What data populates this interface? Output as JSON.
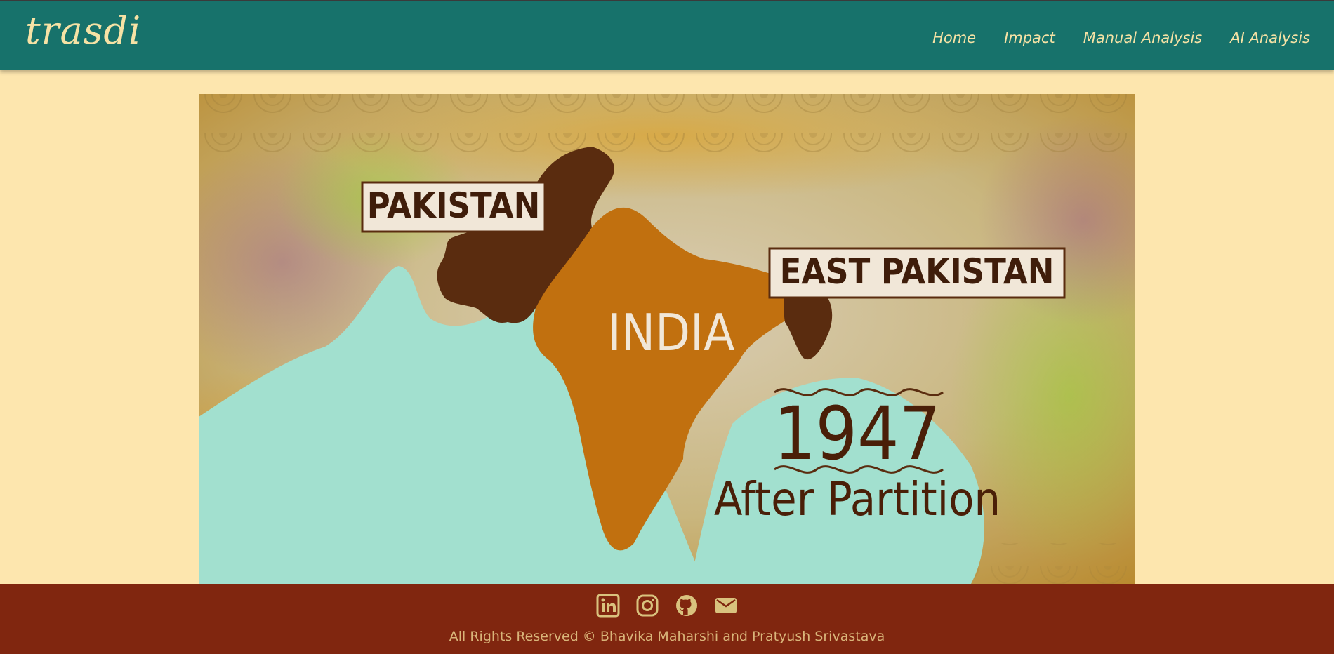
{
  "brand": {
    "name": "trasdi"
  },
  "nav": {
    "items": [
      {
        "label": "Home"
      },
      {
        "label": "Impact"
      },
      {
        "label": "Manual Analysis"
      },
      {
        "label": "AI Analysis"
      }
    ]
  },
  "hero": {
    "labels": {
      "pakistan": "PAKISTAN",
      "east_pakistan": "EAST PAKISTAN",
      "india": "INDIA",
      "year": "1947",
      "caption": "After Partition"
    },
    "colors": {
      "india": "#c1700f",
      "pakistan": "#5a2c0f",
      "sea": "#a2e0cf"
    }
  },
  "footer": {
    "icons": [
      "linkedin-icon",
      "instagram-icon",
      "github-icon",
      "email-icon"
    ],
    "copyright": "All Rights Reserved © Bhavika Maharshi and Pratyush Srivastava"
  }
}
